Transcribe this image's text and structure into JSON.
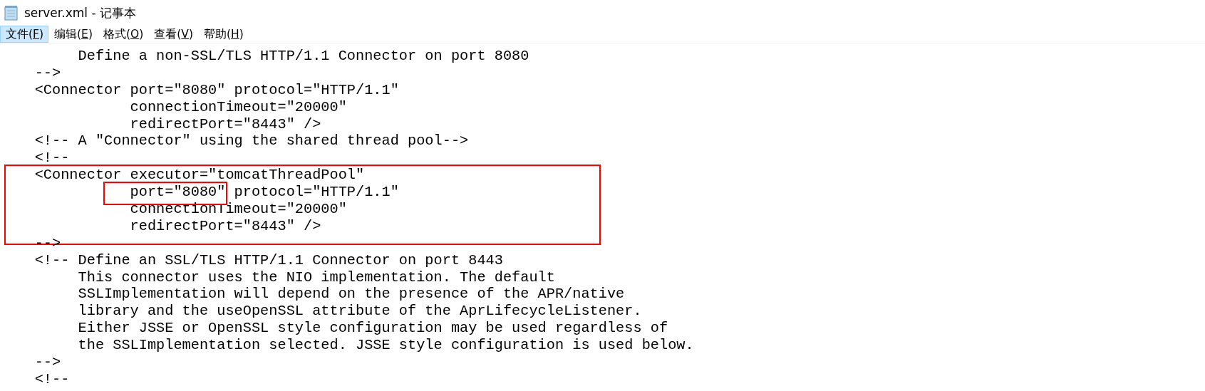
{
  "window": {
    "title": "server.xml - 记事本"
  },
  "menu": [
    {
      "label": "文件(F)",
      "selected": true
    },
    {
      "label": "编辑(E)",
      "selected": false
    },
    {
      "label": "格式(O)",
      "selected": false
    },
    {
      "label": "查看(V)",
      "selected": false
    },
    {
      "label": "帮助(H)",
      "selected": false
    }
  ],
  "editor": {
    "blocks": [
      {
        "lines": [
          [
            {
              "text": "         Define a non-SSL/TLS HTTP/1.1 Connector on port 8080"
            }
          ],
          [
            {
              "text": "    -->"
            }
          ],
          [
            {
              "text": "    <Connector port=\"8080\" protocol=\"HTTP/1.1\""
            }
          ],
          [
            {
              "text": "               connectionTimeout=\"20000\""
            }
          ],
          [
            {
              "text": "               redirectPort=\"8443\" />"
            }
          ],
          [
            {
              "text": "    <!-- A \"Connector\" using the shared thread pool-->"
            }
          ],
          [
            {
              "text": "    <!--"
            }
          ]
        ]
      },
      {
        "framed": true,
        "lines": [
          [
            {
              "text": "    <Connector executor=\"tomcatThreadPool\""
            }
          ],
          [
            {
              "text": "               port=\"8080\"",
              "boxed": true
            },
            {
              "text": " protocol=\"HTTP/1.1\""
            }
          ],
          [
            {
              "text": "               connectionTimeout=\"20000\""
            }
          ],
          [
            {
              "text": "               redirectPort=\"8443\" />"
            }
          ]
        ]
      },
      {
        "lines": [
          [
            {
              "text": "    -->"
            }
          ],
          [
            {
              "text": "    <!-- Define an SSL/TLS HTTP/1.1 Connector on port 8443"
            }
          ],
          [
            {
              "text": "         This connector uses the NIO implementation. The default"
            }
          ],
          [
            {
              "text": "         SSLImplementation will depend on the presence of the APR/native"
            }
          ],
          [
            {
              "text": "         library and the useOpenSSL attribute of the AprLifecycleListener."
            }
          ],
          [
            {
              "text": "         Either JSSE or OpenSSL style configuration may be used regardless of"
            }
          ],
          [
            {
              "text": "         the SSLImplementation selected. JSSE style configuration is used below."
            }
          ],
          [
            {
              "text": "    -->"
            }
          ],
          [
            {
              "text": "    <!--"
            }
          ]
        ]
      }
    ]
  }
}
